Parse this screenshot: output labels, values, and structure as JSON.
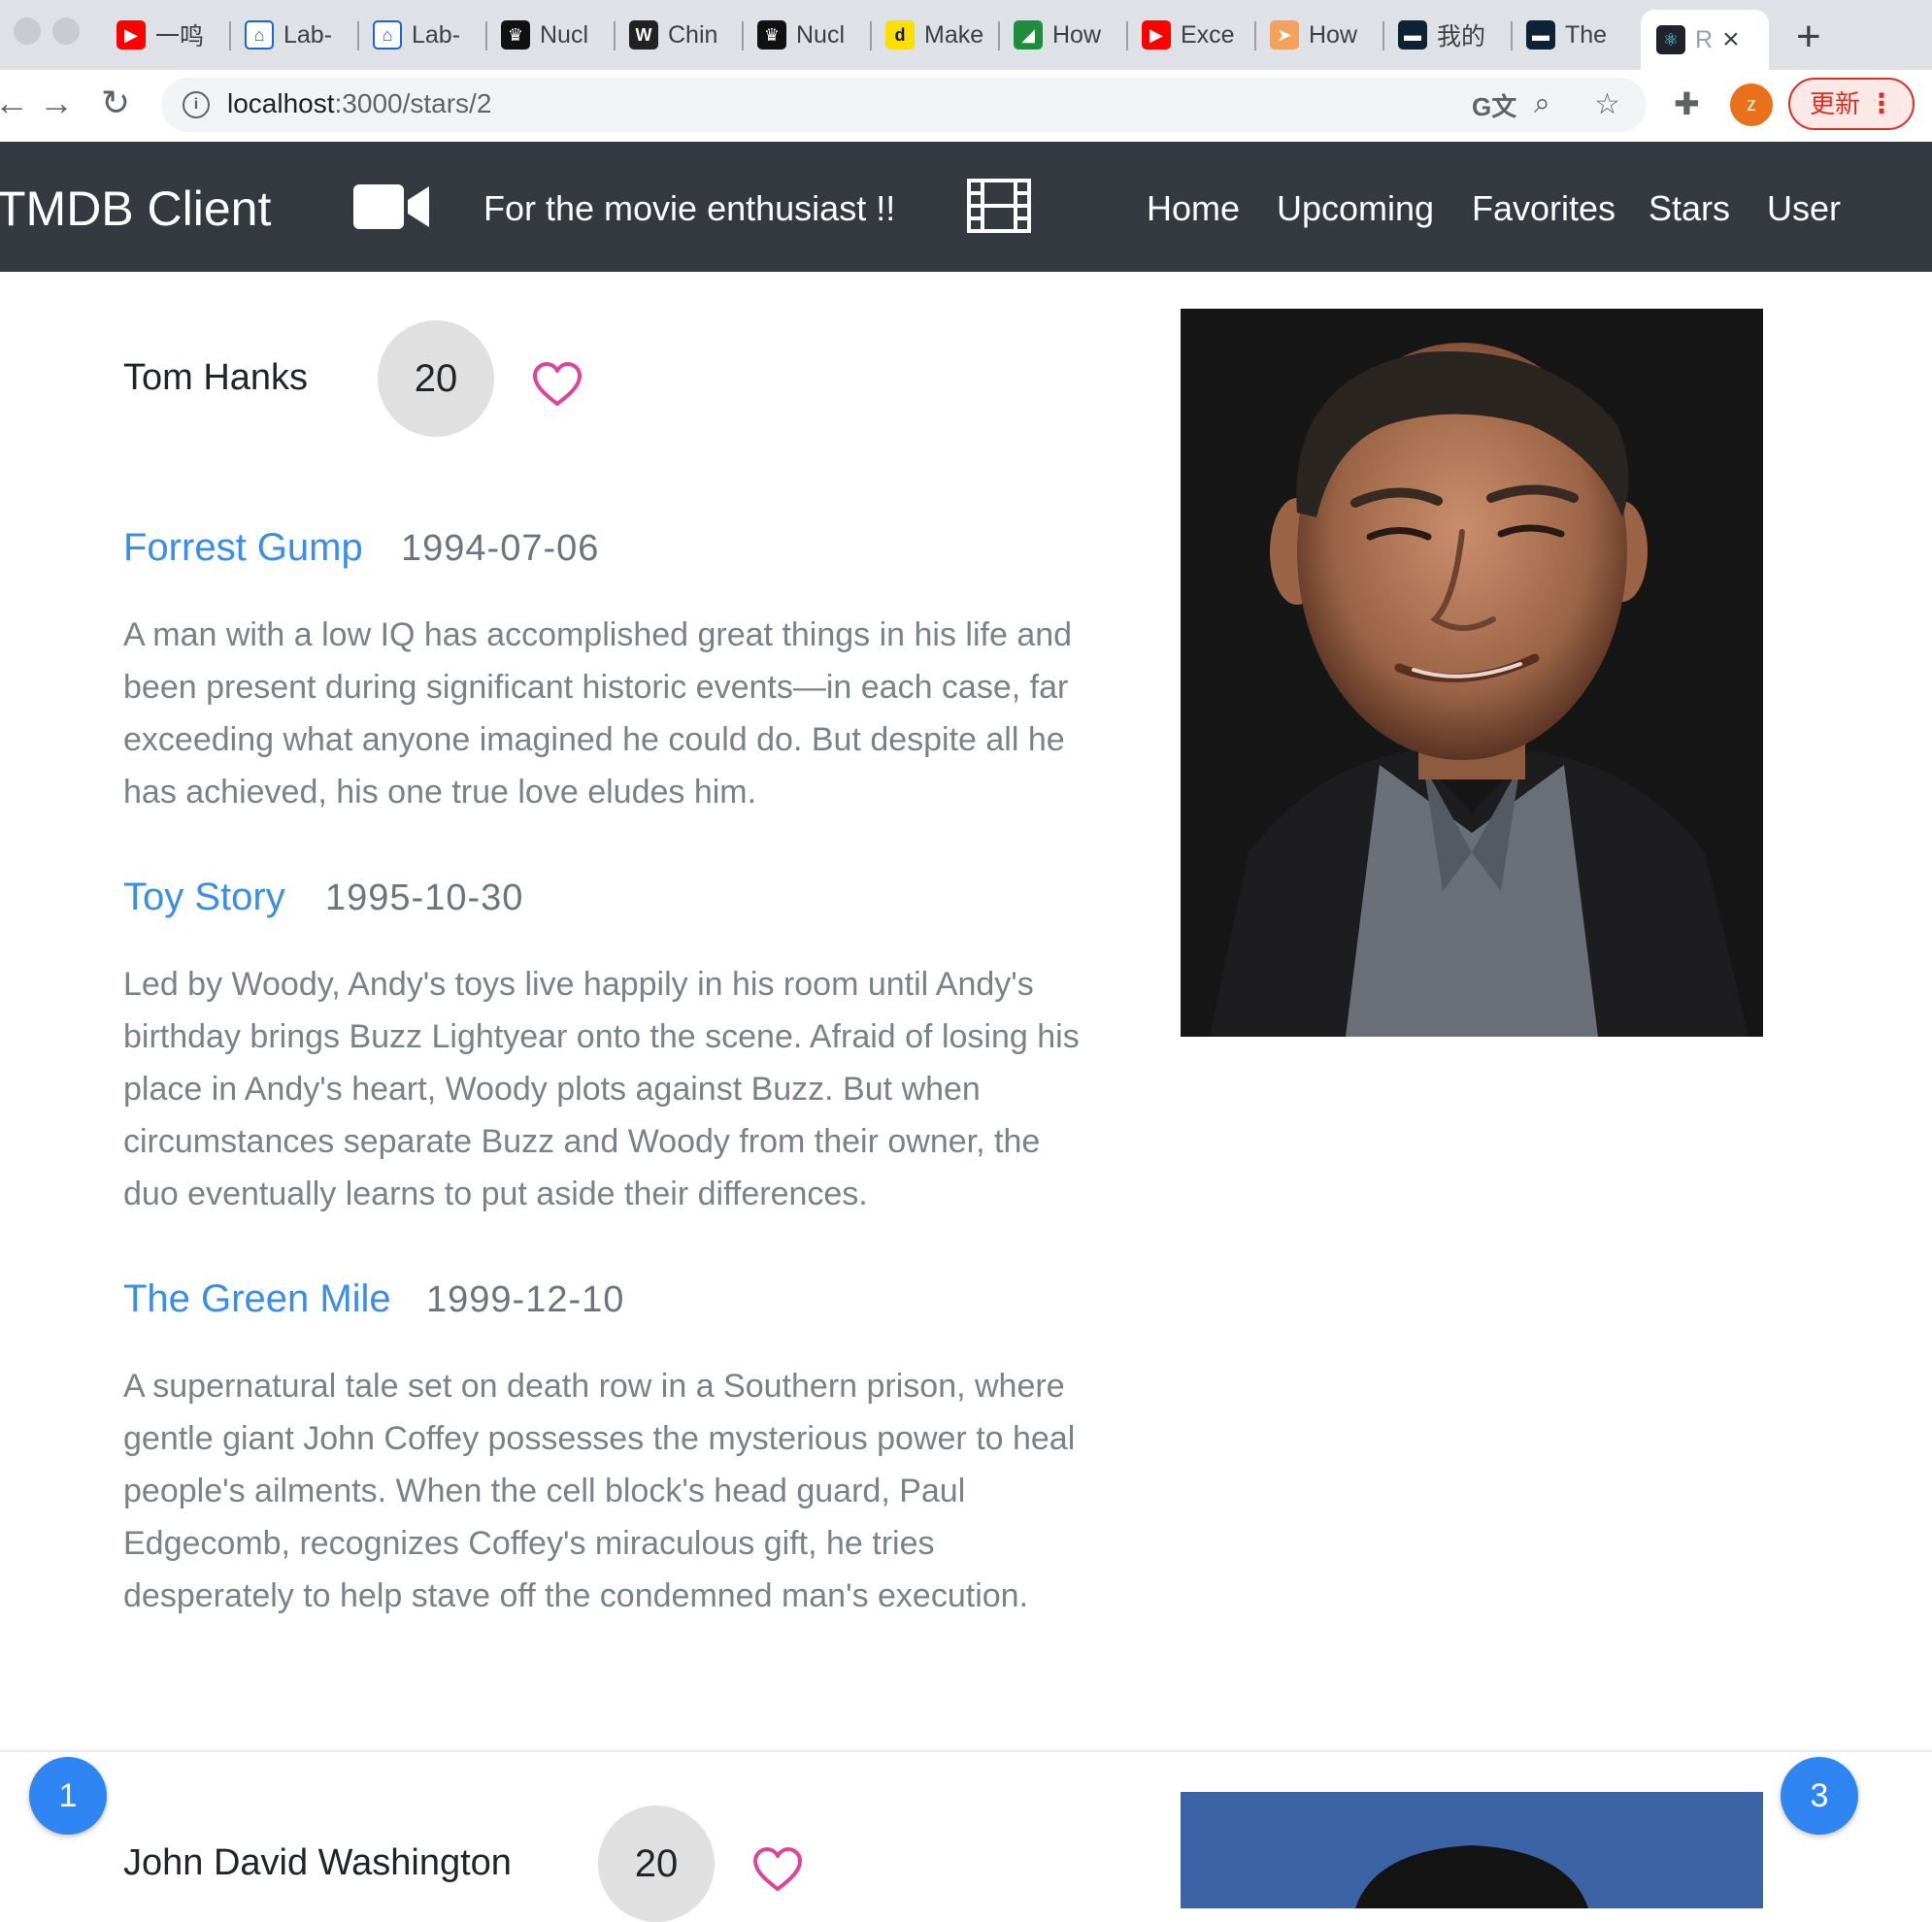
{
  "browser": {
    "tabs": [
      {
        "label": "一鸣",
        "fav": "youtube-icon",
        "color": "#ff0000"
      },
      {
        "label": "Lab-",
        "fav": "lab-icon",
        "color": "#1967d2"
      },
      {
        "label": "Lab-",
        "fav": "lab-icon",
        "color": "#1967d2"
      },
      {
        "label": "Nucl",
        "fav": "crown-icon",
        "color": "#111111"
      },
      {
        "label": "Chin",
        "fav": "w-icon",
        "color": "#222222"
      },
      {
        "label": "Nucl",
        "fav": "crown-icon",
        "color": "#111111"
      },
      {
        "label": "Make",
        "fav": "d-icon",
        "color": "#f9e000"
      },
      {
        "label": "How",
        "fav": "leaf-icon",
        "color": "#1e8e3e"
      },
      {
        "label": "Exce",
        "fav": "youtube-icon",
        "color": "#ff0000"
      },
      {
        "label": "How",
        "fav": "arrow-icon",
        "color": "#f4a25b"
      },
      {
        "label": "我的",
        "fav": "dash-icon",
        "color": "#0d2235"
      },
      {
        "label": "The",
        "fav": "dash-icon",
        "color": "#0d2235"
      }
    ],
    "active_tab": {
      "label": "R",
      "fav": "react-icon",
      "color": "#61dafb"
    },
    "new_tab": "+",
    "url_host": "localhost",
    "url_path": ":3000/stars/2",
    "profile_initial": "z",
    "update_label": "更新"
  },
  "navbar": {
    "brand": "TMDB Client",
    "tagline": "For the movie enthusiast !!",
    "links": [
      "Home",
      "Upcoming",
      "Favorites",
      "Stars",
      "User"
    ]
  },
  "stars": [
    {
      "name": "Tom Hanks",
      "score": "20",
      "movies": [
        {
          "title": "Forrest Gump",
          "date": "1994-07-06",
          "overview": "A man with a low IQ has accomplished great things in his life and been present during significant historic events—in each case, far exceeding what anyone imagined he could do. But despite all he has achieved, his one true love eludes him."
        },
        {
          "title": "Toy Story",
          "date": "1995-10-30",
          "overview": "Led by Woody, Andy's toys live happily in his room until Andy's birthday brings Buzz Lightyear onto the scene. Afraid of losing his place in Andy's heart, Woody plots against Buzz. But when circumstances separate Buzz and Woody from their owner, the duo eventually learns to put aside their differences."
        },
        {
          "title": "The Green Mile",
          "date": "1999-12-10",
          "overview": "A supernatural tale set on death row in a Southern prison, where gentle giant John Coffey possesses the mysterious power to heal people's ailments. When the cell block's head guard, Paul Edgecomb, recognizes Coffey's miraculous gift, he tries desperately to help stave off the condemned man's execution."
        }
      ]
    },
    {
      "name": "John David Washington",
      "score": "20"
    }
  ],
  "pagination": {
    "prev": "1",
    "next": "3"
  },
  "colors": {
    "navbar": "#343a40",
    "link": "#3b8ee8",
    "heart": "#e0439a",
    "page_button": "#2f86f3"
  }
}
